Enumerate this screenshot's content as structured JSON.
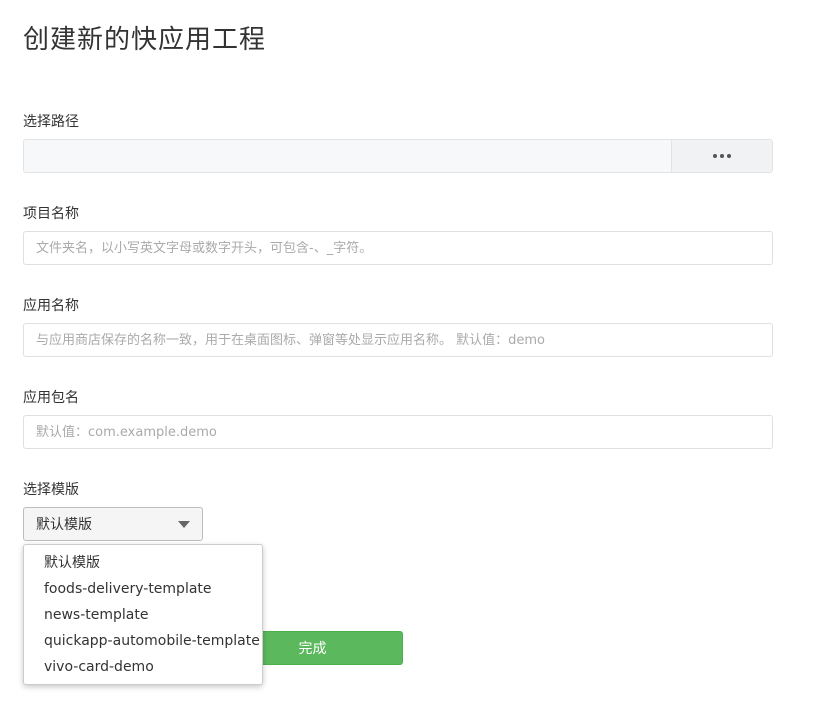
{
  "page": {
    "title": "创建新的快应用工程"
  },
  "path": {
    "label": "选择路径",
    "value": "",
    "browse_icon": "more-dots-icon"
  },
  "project_name": {
    "label": "项目名称",
    "placeholder": "文件夹名，以小写英文字母或数字开头，可包含-、_字符。"
  },
  "app_name": {
    "label": "应用名称",
    "placeholder": "与应用商店保存的名称一致，用于在桌面图标、弹窗等处显示应用名称。 默认值：demo"
  },
  "package_name": {
    "label": "应用包名",
    "placeholder": "默认值：com.example.demo"
  },
  "template": {
    "label": "选择模版",
    "selected": "默认模版",
    "options": [
      "默认模版",
      "foods-delivery-template",
      "news-template",
      "quickapp-automobile-template",
      "vivo-card-demo"
    ]
  },
  "actions": {
    "done_label": "完成",
    "done_color": "#5cb85c",
    "secondary_color": "#f0ad4e"
  }
}
